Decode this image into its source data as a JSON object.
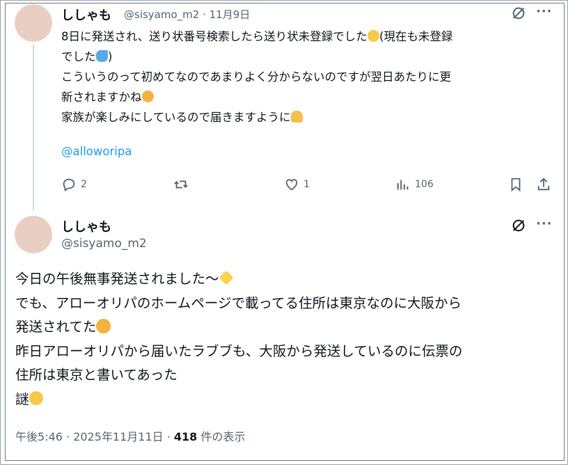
{
  "tweet1": {
    "name": "ししゃも",
    "handle": "@sisyamo_m2",
    "date": "11月9日",
    "lines": [
      "8日に発送され、送り状番号検索したら送り状未登録でした",
      "(現在も未登録",
      "でした",
      ")",
      "こういうのって初めてなのであまりよく分からないのですが翌日あたりに更",
      "新されますかね",
      "家族が楽しみにしているので届きますように"
    ],
    "link": "@alloworipa",
    "actions": {
      "replies": "2",
      "likes": "1",
      "views": "106"
    }
  },
  "tweet2": {
    "name": "ししゃも",
    "handle": "@sisyamo_m2",
    "lines": [
      "今日の午後無事発送されました〜",
      "でも、アローオリパのホームページで載ってる住所は東京なのに大阪から",
      "発送されてた",
      "昨日アローオリパから届いたラブブも、大阪から発送しているのに伝票の",
      "住所は東京と書いてあった",
      "謎"
    ],
    "footer": {
      "timestamp": "午後5:46 · 2025年11月11日 · ",
      "views": "418",
      "views_label": " 件の表示"
    }
  },
  "icons": {
    "pleading": "pleading-face-icon",
    "sweat": "sweat-droplets-icon",
    "thinking": "thinking-face-icon",
    "pray": "folded-hands-icon",
    "sparkles": "sparkles-icon",
    "expressionless": "expressionless-face-icon"
  },
  "colors": {
    "link": "#1d9bf0",
    "secondary": "#536471",
    "text": "#0f1419",
    "avatar": "#e9cfc3"
  }
}
